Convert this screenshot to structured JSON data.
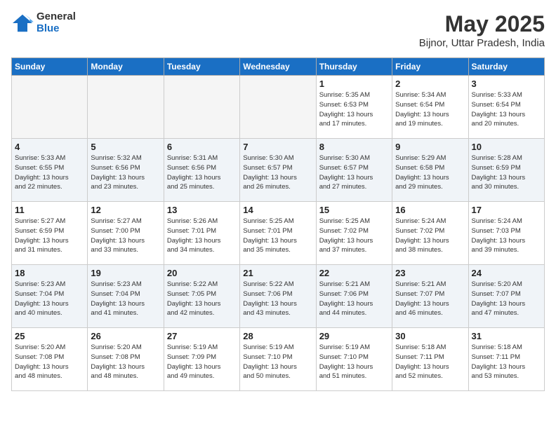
{
  "logo": {
    "general": "General",
    "blue": "Blue"
  },
  "header": {
    "month": "May 2025",
    "location": "Bijnor, Uttar Pradesh, India"
  },
  "weekdays": [
    "Sunday",
    "Monday",
    "Tuesday",
    "Wednesday",
    "Thursday",
    "Friday",
    "Saturday"
  ],
  "weeks": [
    [
      {
        "day": "",
        "info": ""
      },
      {
        "day": "",
        "info": ""
      },
      {
        "day": "",
        "info": ""
      },
      {
        "day": "",
        "info": ""
      },
      {
        "day": "1",
        "info": "Sunrise: 5:35 AM\nSunset: 6:53 PM\nDaylight: 13 hours\nand 17 minutes."
      },
      {
        "day": "2",
        "info": "Sunrise: 5:34 AM\nSunset: 6:54 PM\nDaylight: 13 hours\nand 19 minutes."
      },
      {
        "day": "3",
        "info": "Sunrise: 5:33 AM\nSunset: 6:54 PM\nDaylight: 13 hours\nand 20 minutes."
      }
    ],
    [
      {
        "day": "4",
        "info": "Sunrise: 5:33 AM\nSunset: 6:55 PM\nDaylight: 13 hours\nand 22 minutes."
      },
      {
        "day": "5",
        "info": "Sunrise: 5:32 AM\nSunset: 6:56 PM\nDaylight: 13 hours\nand 23 minutes."
      },
      {
        "day": "6",
        "info": "Sunrise: 5:31 AM\nSunset: 6:56 PM\nDaylight: 13 hours\nand 25 minutes."
      },
      {
        "day": "7",
        "info": "Sunrise: 5:30 AM\nSunset: 6:57 PM\nDaylight: 13 hours\nand 26 minutes."
      },
      {
        "day": "8",
        "info": "Sunrise: 5:30 AM\nSunset: 6:57 PM\nDaylight: 13 hours\nand 27 minutes."
      },
      {
        "day": "9",
        "info": "Sunrise: 5:29 AM\nSunset: 6:58 PM\nDaylight: 13 hours\nand 29 minutes."
      },
      {
        "day": "10",
        "info": "Sunrise: 5:28 AM\nSunset: 6:59 PM\nDaylight: 13 hours\nand 30 minutes."
      }
    ],
    [
      {
        "day": "11",
        "info": "Sunrise: 5:27 AM\nSunset: 6:59 PM\nDaylight: 13 hours\nand 31 minutes."
      },
      {
        "day": "12",
        "info": "Sunrise: 5:27 AM\nSunset: 7:00 PM\nDaylight: 13 hours\nand 33 minutes."
      },
      {
        "day": "13",
        "info": "Sunrise: 5:26 AM\nSunset: 7:01 PM\nDaylight: 13 hours\nand 34 minutes."
      },
      {
        "day": "14",
        "info": "Sunrise: 5:25 AM\nSunset: 7:01 PM\nDaylight: 13 hours\nand 35 minutes."
      },
      {
        "day": "15",
        "info": "Sunrise: 5:25 AM\nSunset: 7:02 PM\nDaylight: 13 hours\nand 37 minutes."
      },
      {
        "day": "16",
        "info": "Sunrise: 5:24 AM\nSunset: 7:02 PM\nDaylight: 13 hours\nand 38 minutes."
      },
      {
        "day": "17",
        "info": "Sunrise: 5:24 AM\nSunset: 7:03 PM\nDaylight: 13 hours\nand 39 minutes."
      }
    ],
    [
      {
        "day": "18",
        "info": "Sunrise: 5:23 AM\nSunset: 7:04 PM\nDaylight: 13 hours\nand 40 minutes."
      },
      {
        "day": "19",
        "info": "Sunrise: 5:23 AM\nSunset: 7:04 PM\nDaylight: 13 hours\nand 41 minutes."
      },
      {
        "day": "20",
        "info": "Sunrise: 5:22 AM\nSunset: 7:05 PM\nDaylight: 13 hours\nand 42 minutes."
      },
      {
        "day": "21",
        "info": "Sunrise: 5:22 AM\nSunset: 7:06 PM\nDaylight: 13 hours\nand 43 minutes."
      },
      {
        "day": "22",
        "info": "Sunrise: 5:21 AM\nSunset: 7:06 PM\nDaylight: 13 hours\nand 44 minutes."
      },
      {
        "day": "23",
        "info": "Sunrise: 5:21 AM\nSunset: 7:07 PM\nDaylight: 13 hours\nand 46 minutes."
      },
      {
        "day": "24",
        "info": "Sunrise: 5:20 AM\nSunset: 7:07 PM\nDaylight: 13 hours\nand 47 minutes."
      }
    ],
    [
      {
        "day": "25",
        "info": "Sunrise: 5:20 AM\nSunset: 7:08 PM\nDaylight: 13 hours\nand 48 minutes."
      },
      {
        "day": "26",
        "info": "Sunrise: 5:20 AM\nSunset: 7:08 PM\nDaylight: 13 hours\nand 48 minutes."
      },
      {
        "day": "27",
        "info": "Sunrise: 5:19 AM\nSunset: 7:09 PM\nDaylight: 13 hours\nand 49 minutes."
      },
      {
        "day": "28",
        "info": "Sunrise: 5:19 AM\nSunset: 7:10 PM\nDaylight: 13 hours\nand 50 minutes."
      },
      {
        "day": "29",
        "info": "Sunrise: 5:19 AM\nSunset: 7:10 PM\nDaylight: 13 hours\nand 51 minutes."
      },
      {
        "day": "30",
        "info": "Sunrise: 5:18 AM\nSunset: 7:11 PM\nDaylight: 13 hours\nand 52 minutes."
      },
      {
        "day": "31",
        "info": "Sunrise: 5:18 AM\nSunset: 7:11 PM\nDaylight: 13 hours\nand 53 minutes."
      }
    ]
  ]
}
